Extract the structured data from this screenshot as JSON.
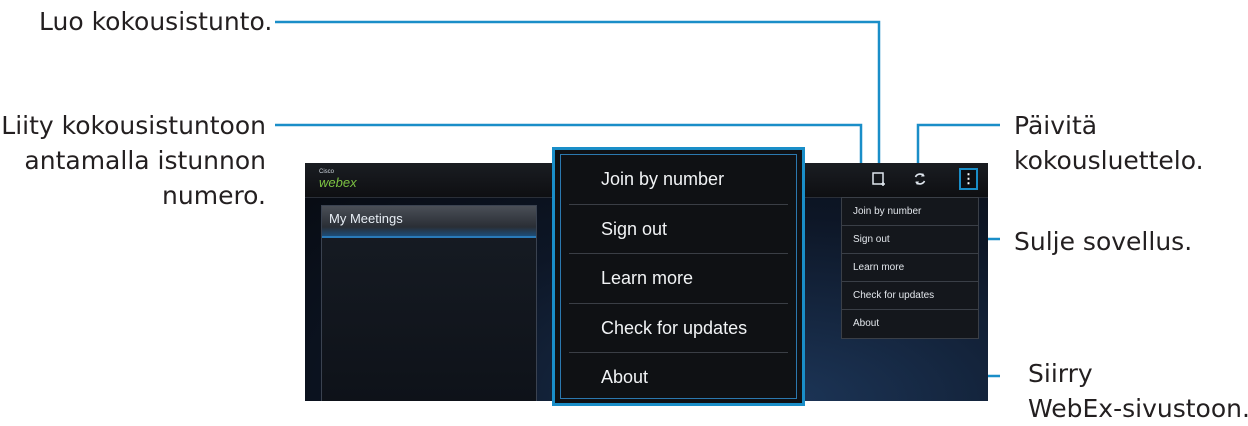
{
  "callouts": {
    "create_session": "Luo kokousistunto.",
    "join_line1": "Liity kokousistuntoon",
    "join_line2": "antamalla istunnon",
    "join_line3": "numero.",
    "refresh_line1": "Päivitä",
    "refresh_line2": "kokousluettelo.",
    "close_app": "Sulje sovellus.",
    "goto_line1": "Siirry",
    "goto_line2": "WebEx-sivustoon."
  },
  "app": {
    "logo_small": "Cisco",
    "logo_main": "webex",
    "left_panel_title": "My Meetings",
    "overflow_glyph": "⋮",
    "create_icon": "create-session-icon",
    "refresh_icon": "refresh-icon"
  },
  "menu": {
    "items": [
      "Join by number",
      "Sign out",
      "Learn more",
      "Check for updates",
      "About"
    ]
  },
  "colors": {
    "leader": "#1a8ec8",
    "accent_green": "#7cc242"
  }
}
